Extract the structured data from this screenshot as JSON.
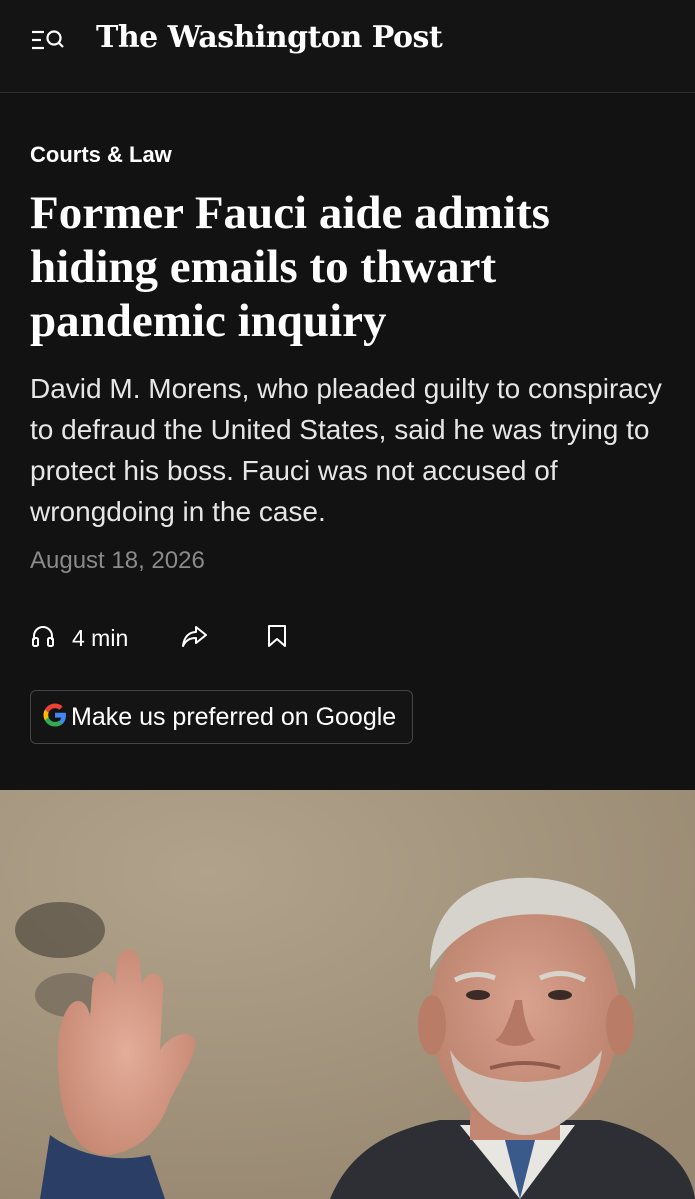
{
  "header": {
    "masthead": "The Washington Post",
    "menu_icon": "menu-search-icon"
  },
  "article": {
    "section": "Courts & Law",
    "headline": "Former Fauci aide admits hiding emails to thwart pandemic inquiry",
    "dek": "David M. Morens, who pleaded guilty to conspiracy to defraud the United States, said he was trying to protect his boss. Fauci was not accused of wrongdoing in the case.",
    "date": "August 18, 2026"
  },
  "actions": {
    "listen_label": "4 min",
    "listen_icon": "headphones-icon",
    "share_icon": "share-icon",
    "save_icon": "bookmark-icon"
  },
  "google_preference": {
    "label": "Make us preferred on Google",
    "logo": "G"
  },
  "photo": {
    "icon": "article-photo"
  },
  "colors": {
    "background": "#121212",
    "date_gray": "#8a8a8a",
    "google_blue": "#4285f4",
    "google_red": "#ea4335",
    "google_yellow": "#fbbc05",
    "google_green": "#34a853"
  }
}
